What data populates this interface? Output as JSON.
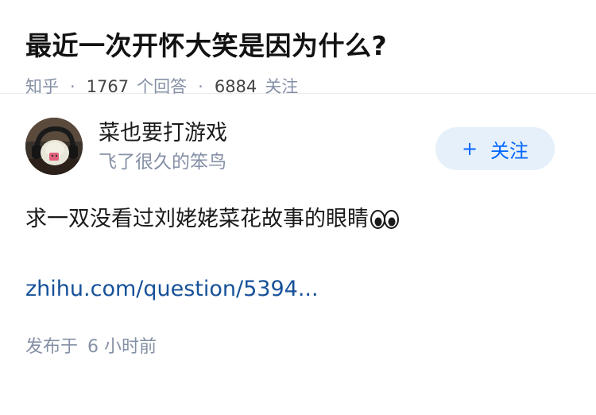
{
  "question": {
    "title": "最近一次开怀大笑是因为什么?",
    "source": "知乎",
    "answer_count": "1767",
    "answer_label": "个回答",
    "follower_count": "6884",
    "follower_label": "关注",
    "separator": "·"
  },
  "answer": {
    "author": {
      "name": "菜也要打游戏",
      "bio": "飞了很久的笨鸟"
    },
    "follow_button": {
      "plus": "+",
      "label": "关注"
    },
    "content": "求一双没看过刘姥姥菜花故事的眼睛",
    "content_emoji": "eyes-icon",
    "link_text": "zhihu.com/question/5394...",
    "publish": {
      "label": "发布于",
      "time": "6 小时前"
    }
  },
  "colors": {
    "meta_gray": "#8590a6",
    "link_blue": "#175199",
    "accent_blue": "#0066ff",
    "follow_bg": "#e6f0fb"
  }
}
